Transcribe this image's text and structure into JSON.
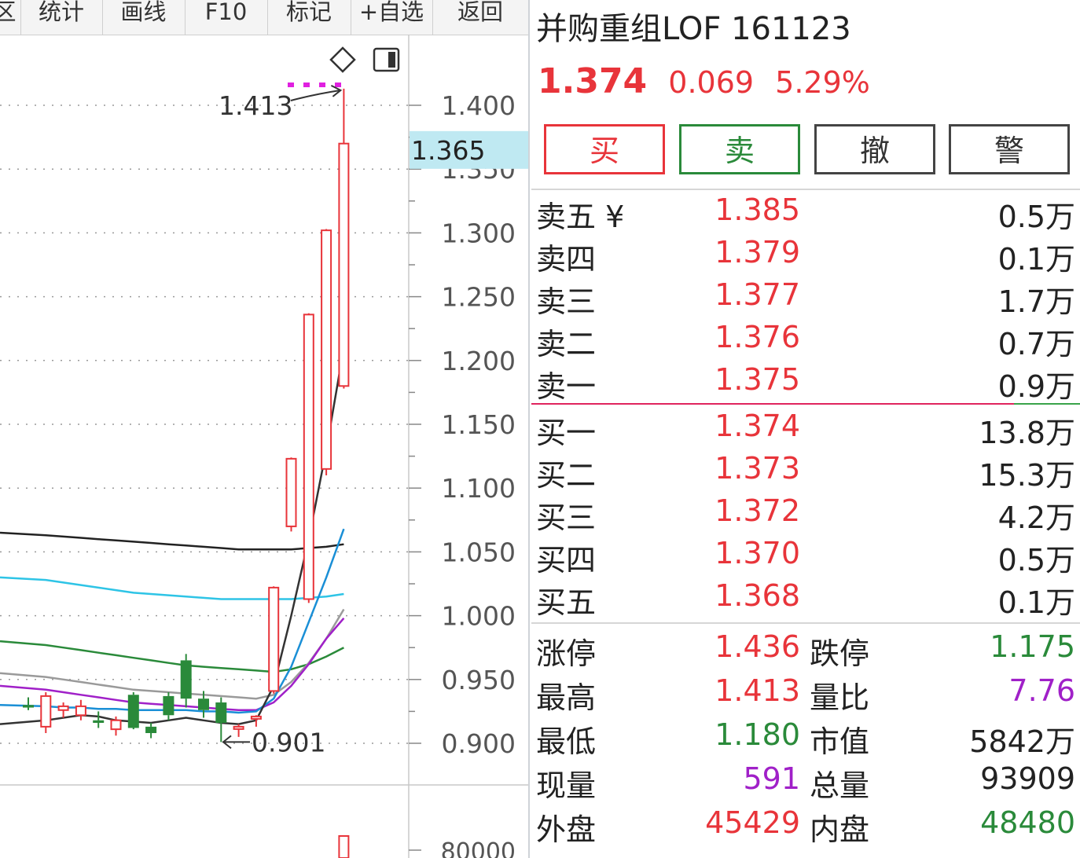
{
  "toolbar": {
    "items": [
      "统计",
      "画线",
      "F10",
      "标记",
      "+自选",
      "返回"
    ],
    "cut_left": "区"
  },
  "quote": {
    "name_code": "并购重组LOF 161123",
    "price": "1.374",
    "change": "0.069",
    "change_pct": "5.29%"
  },
  "actions": {
    "buy": "买",
    "sell": "卖",
    "cancel": "撤",
    "alert": "警"
  },
  "colors": {
    "up": "#e8343a",
    "down": "#2a8a3a",
    "purple": "#a020c8",
    "cross_bg": "#bfe9f2"
  },
  "orderbook": {
    "asks": [
      {
        "label": "卖五 ¥",
        "price": "1.385",
        "vol": "0.5万"
      },
      {
        "label": "卖四",
        "price": "1.379",
        "vol": "0.1万"
      },
      {
        "label": "卖三",
        "price": "1.377",
        "vol": "1.7万"
      },
      {
        "label": "卖二",
        "price": "1.376",
        "vol": "0.7万"
      },
      {
        "label": "卖一",
        "price": "1.375",
        "vol": "0.9万"
      }
    ],
    "bids": [
      {
        "label": "买一",
        "price": "1.374",
        "vol": "13.8万"
      },
      {
        "label": "买二",
        "price": "1.373",
        "vol": "15.3万"
      },
      {
        "label": "买三",
        "price": "1.372",
        "vol": "4.2万"
      },
      {
        "label": "买四",
        "price": "1.370",
        "vol": "0.5万"
      },
      {
        "label": "买五",
        "price": "1.368",
        "vol": "0.1万"
      }
    ]
  },
  "stats": [
    {
      "l1": "涨停",
      "v1": "1.436",
      "c1": "up",
      "l2": "跌停",
      "v2": "1.175",
      "c2": "down"
    },
    {
      "l1": "最高",
      "v1": "1.413",
      "c1": "up",
      "l2": "量比",
      "v2": "7.76",
      "c2": "purple"
    },
    {
      "l1": "最低",
      "v1": "1.180",
      "c1": "down",
      "l2": "市值",
      "v2": "5842万",
      "c2": "black"
    },
    {
      "l1": "现量",
      "v1": "591",
      "c1": "purple",
      "l2": "总量",
      "v2": "93909",
      "c2": "black"
    },
    {
      "l1": "外盘",
      "v1": "45429",
      "c1": "up",
      "l2": "内盘",
      "v2": "48480",
      "c2": "down"
    }
  ],
  "chart_data": {
    "type": "candlestick",
    "y_ticks": [
      "1.400",
      "1.350",
      "1.300",
      "1.250",
      "1.200",
      "1.150",
      "1.100",
      "1.050",
      "1.000",
      "0.950",
      "0.900"
    ],
    "volume_tick": "80000",
    "crosshair_value": "1.365",
    "annotations": {
      "high": "1.413",
      "low": "0.901"
    },
    "ylim": [
      0.885,
      1.42
    ],
    "candles": [
      {
        "o": 0.93,
        "h": 0.936,
        "l": 0.926,
        "c": 0.928
      },
      {
        "o": 0.913,
        "h": 0.94,
        "l": 0.908,
        "c": 0.937
      },
      {
        "o": 0.926,
        "h": 0.932,
        "l": 0.92,
        "c": 0.929
      },
      {
        "o": 0.922,
        "h": 0.934,
        "l": 0.918,
        "c": 0.929
      },
      {
        "o": 0.918,
        "h": 0.925,
        "l": 0.912,
        "c": 0.916
      },
      {
        "o": 0.911,
        "h": 0.921,
        "l": 0.906,
        "c": 0.918
      },
      {
        "o": 0.938,
        "h": 0.94,
        "l": 0.911,
        "c": 0.912
      },
      {
        "o": 0.913,
        "h": 0.916,
        "l": 0.904,
        "c": 0.908
      },
      {
        "o": 0.937,
        "h": 0.94,
        "l": 0.918,
        "c": 0.922
      },
      {
        "o": 0.965,
        "h": 0.97,
        "l": 0.928,
        "c": 0.935
      },
      {
        "o": 0.935,
        "h": 0.941,
        "l": 0.92,
        "c": 0.926
      },
      {
        "o": 0.932,
        "h": 0.936,
        "l": 0.901,
        "c": 0.916
      },
      {
        "o": 0.912,
        "h": 0.915,
        "l": 0.905,
        "c": 0.913
      },
      {
        "o": 0.92,
        "h": 0.922,
        "l": 0.913,
        "c": 0.921
      },
      {
        "o": 0.941,
        "h": 1.023,
        "l": 0.939,
        "c": 1.022
      },
      {
        "o": 1.07,
        "h": 1.124,
        "l": 1.066,
        "c": 1.123
      },
      {
        "o": 1.013,
        "h": 1.237,
        "l": 1.01,
        "c": 1.236
      },
      {
        "o": 1.115,
        "h": 1.303,
        "l": 1.11,
        "c": 1.302
      },
      {
        "o": 1.18,
        "h": 1.413,
        "l": 1.178,
        "c": 1.37
      }
    ],
    "ma_lines": [
      {
        "color": "#222222",
        "values": [
          1.065,
          1.063,
          1.062,
          1.061,
          1.06,
          1.059,
          1.058,
          1.057,
          1.056,
          1.055,
          1.054,
          1.053,
          1.052,
          1.052,
          1.052,
          1.052,
          1.053,
          1.054,
          1.056
        ]
      },
      {
        "color": "#2ec4e6",
        "values": [
          1.03,
          1.028,
          1.026,
          1.024,
          1.022,
          1.02,
          1.018,
          1.017,
          1.016,
          1.015,
          1.014,
          1.013,
          1.013,
          1.013,
          1.013,
          1.013,
          1.014,
          1.015,
          1.017
        ]
      },
      {
        "color": "#2a8a3a",
        "values": [
          0.98,
          0.977,
          0.975,
          0.973,
          0.971,
          0.969,
          0.967,
          0.965,
          0.963,
          0.961,
          0.96,
          0.959,
          0.958,
          0.957,
          0.956,
          0.958,
          0.962,
          0.968,
          0.975
        ]
      },
      {
        "color": "#9a9a9a",
        "values": [
          0.955,
          0.952,
          0.95,
          0.948,
          0.946,
          0.944,
          0.942,
          0.941,
          0.94,
          0.939,
          0.938,
          0.937,
          0.936,
          0.935,
          0.938,
          0.948,
          0.963,
          0.982,
          1.005
        ]
      },
      {
        "color": "#a020c8",
        "values": [
          0.945,
          0.942,
          0.94,
          0.938,
          0.936,
          0.934,
          0.932,
          0.931,
          0.93,
          0.929,
          0.928,
          0.927,
          0.926,
          0.926,
          0.932,
          0.945,
          0.962,
          0.982,
          0.998
        ]
      },
      {
        "color": "#1a8fd6",
        "values": [
          0.93,
          0.929,
          0.928,
          0.928,
          0.927,
          0.927,
          0.926,
          0.926,
          0.926,
          0.926,
          0.925,
          0.925,
          0.924,
          0.925,
          0.935,
          0.96,
          0.995,
          1.03,
          1.068
        ]
      },
      {
        "color": "#333333",
        "values": [
          0.915,
          0.918,
          0.92,
          0.922,
          0.921,
          0.918,
          0.917,
          0.916,
          0.918,
          0.92,
          0.918,
          0.916,
          0.915,
          0.918,
          0.945,
          1.0,
          1.06,
          1.13,
          1.21
        ]
      }
    ]
  }
}
